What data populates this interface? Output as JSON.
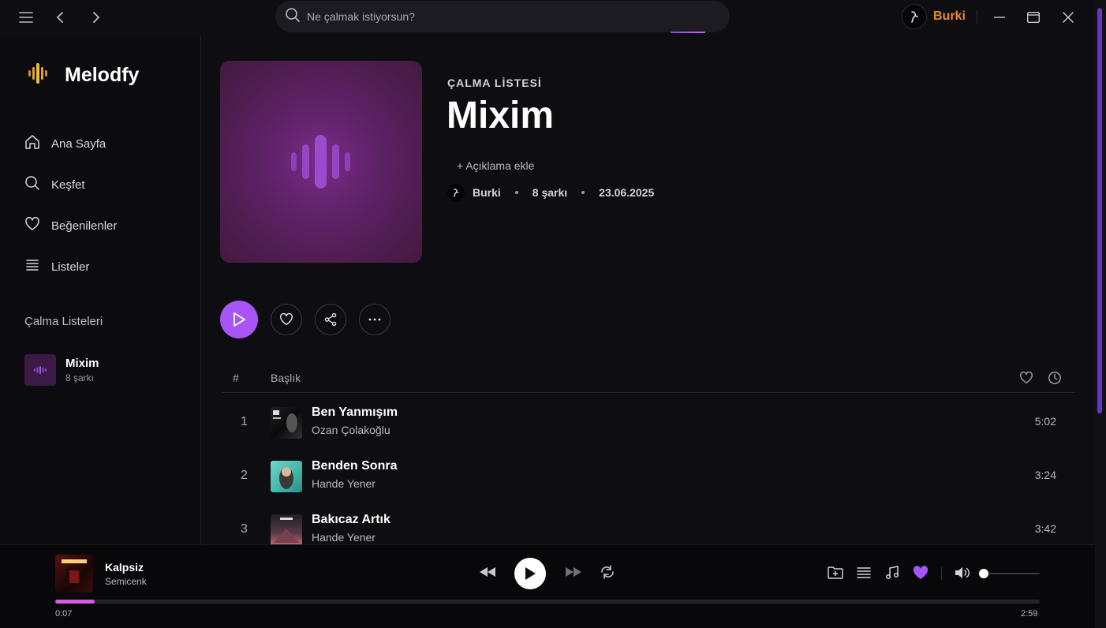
{
  "search": {
    "placeholder": "Ne çalmak istiyorsun?"
  },
  "user": {
    "name": "Burki"
  },
  "app": {
    "name": "Melodfy"
  },
  "nav": [
    {
      "label": "Ana Sayfa",
      "icon": "home-icon"
    },
    {
      "label": "Keşfet",
      "icon": "search-icon"
    },
    {
      "label": "Beğenilenler",
      "icon": "heart-icon"
    },
    {
      "label": "Listeler",
      "icon": "list-icon"
    }
  ],
  "sidebar": {
    "section_title": "Çalma Listeleri",
    "playlists": [
      {
        "name": "Mixim",
        "sub": "8 şarkı"
      }
    ]
  },
  "playlist": {
    "type": "ÇALMA LİSTESİ",
    "title": "Mixim",
    "add_description": "+ Açıklama ekle",
    "owner": "Burki",
    "count": "8 şarkı",
    "date": "23.06.2025"
  },
  "table": {
    "col_num": "#",
    "col_title": "Başlık",
    "rows": [
      {
        "num": "1",
        "title": "Ben Yanmışım",
        "artist": "Ozan Çolakoğlu",
        "duration": "5:02"
      },
      {
        "num": "2",
        "title": "Benden Sonra",
        "artist": "Hande Yener",
        "duration": "3:24"
      },
      {
        "num": "3",
        "title": "Bakıcaz Artık",
        "artist": "Hande Yener",
        "duration": "3:42"
      }
    ]
  },
  "now_playing": {
    "title": "Kalpsiz",
    "artist": "Semicenk",
    "current": "0:07",
    "total": "2:59",
    "progress": 0.04,
    "volume": 0.0
  },
  "colors": {
    "accent": "#a855f7",
    "user_name": "#e88a2d",
    "progress": "#d65ce6"
  }
}
